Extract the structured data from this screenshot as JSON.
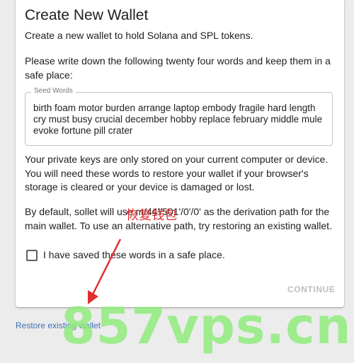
{
  "card": {
    "title": "Create New Wallet",
    "subtitle": "Create a new wallet to hold Solana and SPL tokens.",
    "instruction": "Please write down the following twenty four words and keep them in a safe place:",
    "seed_label": "Seed Words",
    "seed_words": "birth foam motor burden arrange laptop embody fragile hard length cry must busy crucial december hobby replace february middle mule evoke fortune pill crater",
    "keys_notice": "Your private keys are only stored on your current computer or device. You will need these words to restore your wallet if your browser's storage is cleared or your device is damaged or lost.",
    "derivation_notice": "By default, sollet will use m/44'/501'/0'/0' as the derivation path for the main wallet. To use an alternative path, try restoring an existing wallet.",
    "checkbox_label": "I have saved these words in a safe place.",
    "checkbox_checked": false,
    "continue_label": "CONTINUE"
  },
  "restore_link": "Restore existing wallet",
  "watermark": {
    "text": "857vps.cn",
    "cn_text": "恢复钱包",
    "color": "#8ceb78"
  },
  "colors": {
    "link": "#3d6fb6",
    "disabled": "#bdbdbd",
    "annotation": "#e03030"
  }
}
